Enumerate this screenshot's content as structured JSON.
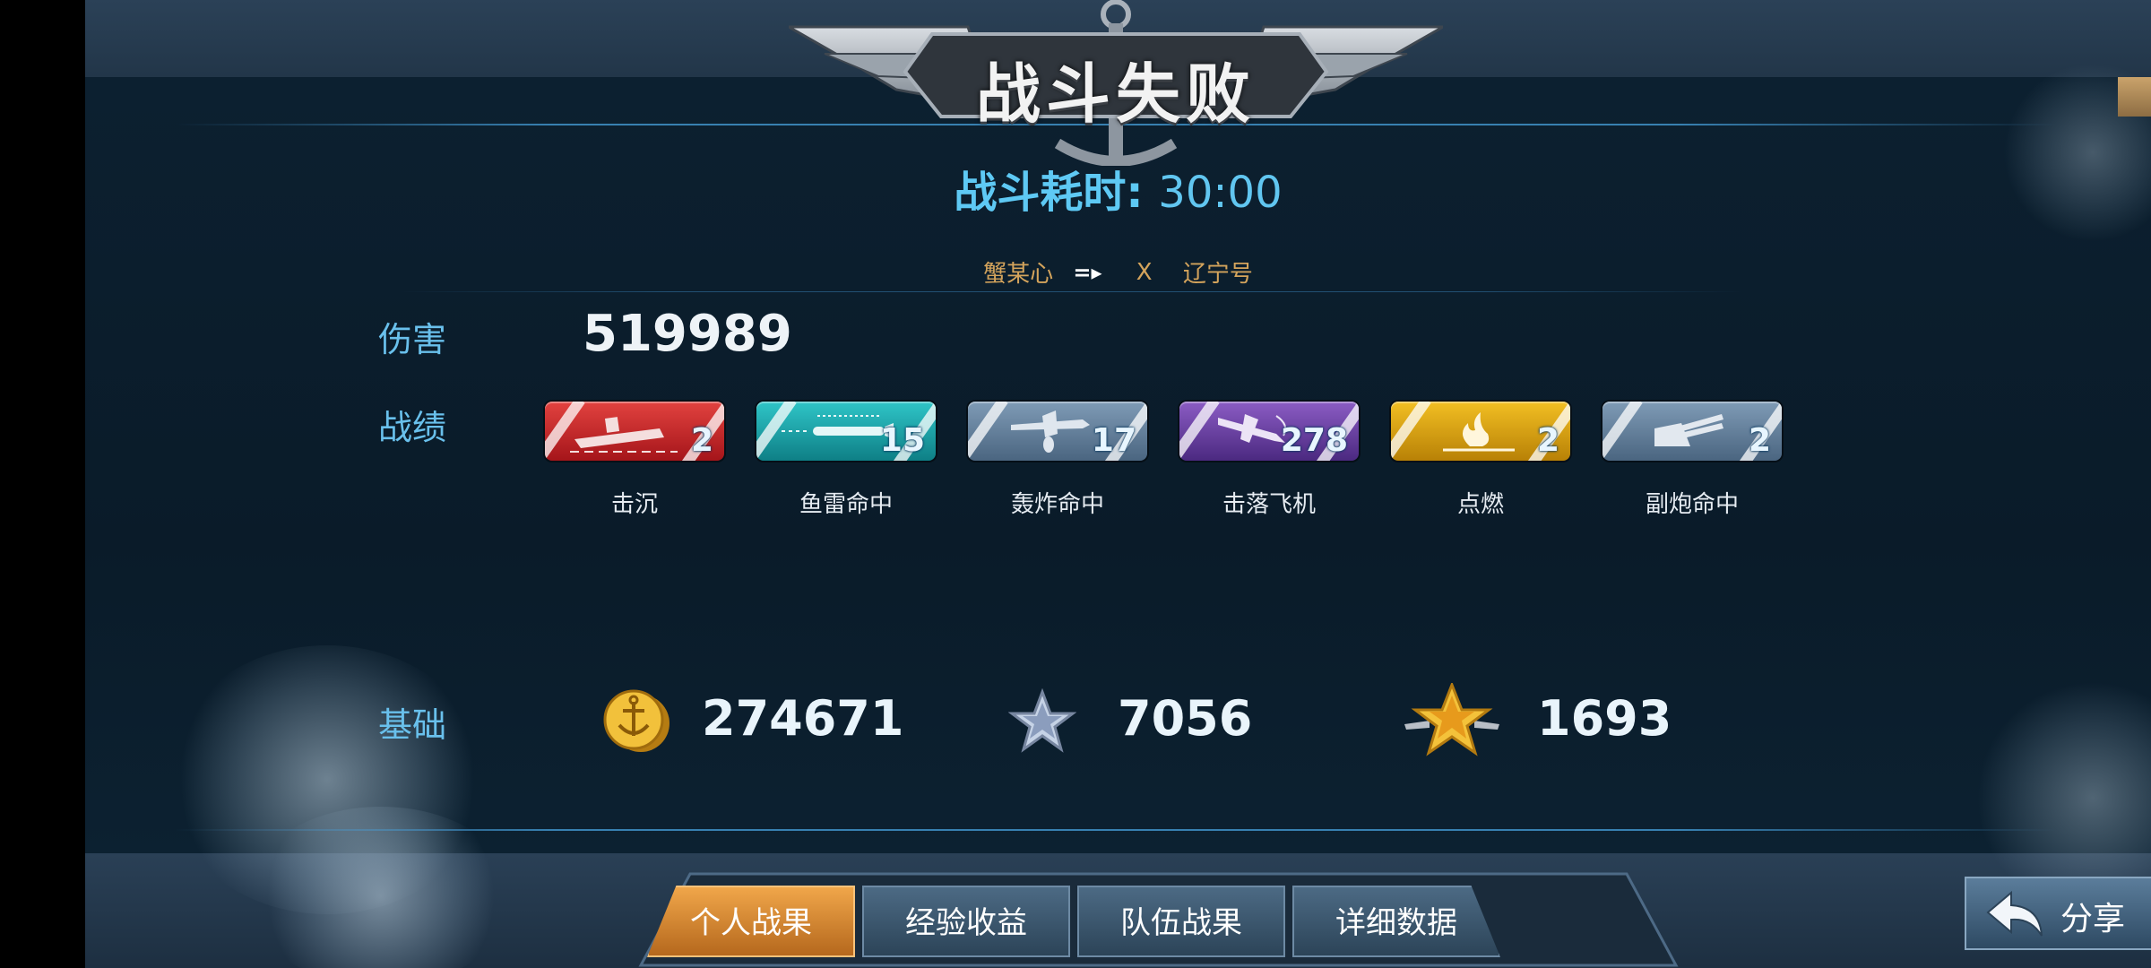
{
  "header": {
    "title": "战斗失败",
    "duration_label": "战斗耗时:",
    "duration_value": "30:00"
  },
  "matchup": {
    "player": "蟹某心",
    "separator": "X",
    "target": "辽宁号"
  },
  "damage": {
    "label": "伤害",
    "value": "519989"
  },
  "stats": {
    "label": "战绩",
    "items": [
      {
        "label": "击沉",
        "count": "2",
        "color": "#c8262a",
        "icon": "sinking-ship-icon"
      },
      {
        "label": "鱼雷命中",
        "count": "15",
        "color": "#1ba3a8",
        "icon": "torpedo-icon"
      },
      {
        "label": "轰炸命中",
        "count": "17",
        "color": "#5c7894",
        "icon": "bomber-icon"
      },
      {
        "label": "击落飞机",
        "count": "278",
        "color": "#6a3fa0",
        "icon": "downed-plane-icon"
      },
      {
        "label": "点燃",
        "count": "2",
        "color": "#d9a112",
        "icon": "fire-icon"
      },
      {
        "label": "副炮命中",
        "count": "2",
        "color": "#5c7894",
        "icon": "turret-icon"
      }
    ]
  },
  "base": {
    "label": "基础",
    "coins": "274671",
    "exp": "7056",
    "rank": "1693"
  },
  "tabs": [
    {
      "label": "个人战果",
      "active": true
    },
    {
      "label": "经验收益",
      "active": false
    },
    {
      "label": "队伍战果",
      "active": false
    },
    {
      "label": "详细数据",
      "active": false
    }
  ],
  "share_label": "分享",
  "close_symbol": "✕"
}
